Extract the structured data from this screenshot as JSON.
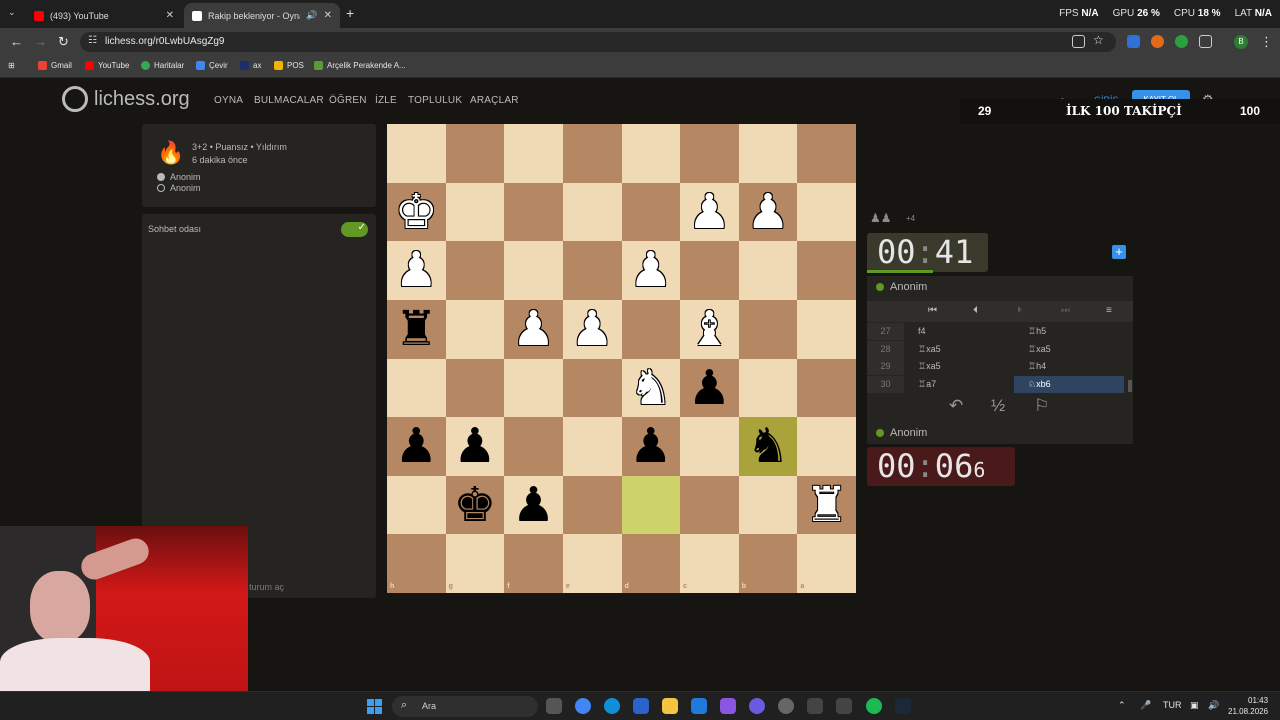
{
  "browser": {
    "tabs": [
      {
        "label": "(493) YouTube",
        "favicon": "youtube-icon"
      },
      {
        "label": "Rakip bekleniyor - Oyna Ar",
        "favicon": "lichess-icon"
      }
    ],
    "url": "lichess.org/r0LwbUAsgZg9",
    "bookmarks": [
      "Gmail",
      "YouTube",
      "Haritalar",
      "Çevir",
      "ax",
      "POS",
      "Arçelik Perakende A..."
    ]
  },
  "hud": {
    "fps_label": "FPS",
    "fps": "N/A",
    "gpu_label": "GPU",
    "gpu": "26 %",
    "cpu_label": "CPU",
    "cpu": "18 %",
    "lat_label": "LAT",
    "lat": "N/A"
  },
  "lichess": {
    "logo": "lichess.org",
    "menu": [
      "OYNA",
      "BULMACALAR",
      "ÖĞREN",
      "İZLE",
      "TOPLULUK",
      "ARAÇLAR"
    ],
    "signin": "GİRİŞ",
    "signup": "KAYIT OL"
  },
  "banner": {
    "left": "29",
    "title": "İLK 100 TAKİPÇİ",
    "right": "100"
  },
  "game": {
    "type": "3+2 • Puansız • Yıldırım",
    "time_ago": "6 dakika önce",
    "players": [
      "Anonim",
      "Anonim"
    ]
  },
  "chat": {
    "title": "Sohbet odası",
    "input_hint": "turum aç"
  },
  "board": {
    "ranks": [
      "1",
      "2",
      "3",
      "4",
      "5",
      "6",
      "7",
      "8"
    ],
    "files": [
      "h",
      "g",
      "f",
      "e",
      "d",
      "c",
      "b",
      "a"
    ],
    "pieces": [
      {
        "sq": [
          1,
          0
        ],
        "glyph": "♚",
        "color": "w"
      },
      {
        "sq": [
          1,
          5
        ],
        "glyph": "♟",
        "color": "w"
      },
      {
        "sq": [
          1,
          6
        ],
        "glyph": "♟",
        "color": "w"
      },
      {
        "sq": [
          2,
          0
        ],
        "glyph": "♟",
        "color": "w"
      },
      {
        "sq": [
          2,
          4
        ],
        "glyph": "♟",
        "color": "w"
      },
      {
        "sq": [
          3,
          0
        ],
        "glyph": "♜",
        "color": "b"
      },
      {
        "sq": [
          3,
          2
        ],
        "glyph": "♟",
        "color": "w"
      },
      {
        "sq": [
          3,
          3
        ],
        "glyph": "♟",
        "color": "w"
      },
      {
        "sq": [
          3,
          5
        ],
        "glyph": "♝",
        "color": "w"
      },
      {
        "sq": [
          4,
          4
        ],
        "glyph": "♞",
        "color": "w"
      },
      {
        "sq": [
          4,
          5
        ],
        "glyph": "♟",
        "color": "b"
      },
      {
        "sq": [
          5,
          0
        ],
        "glyph": "♟",
        "color": "b"
      },
      {
        "sq": [
          5,
          1
        ],
        "glyph": "♟",
        "color": "b"
      },
      {
        "sq": [
          5,
          4
        ],
        "glyph": "♟",
        "color": "b"
      },
      {
        "sq": [
          5,
          6
        ],
        "glyph": "♞",
        "color": "b"
      },
      {
        "sq": [
          6,
          1
        ],
        "glyph": "♚",
        "color": "b"
      },
      {
        "sq": [
          6,
          2
        ],
        "glyph": "♟",
        "color": "b"
      },
      {
        "sq": [
          6,
          7
        ],
        "glyph": "♜",
        "color": "w"
      }
    ],
    "highlights": [
      [
        5,
        6
      ],
      [
        6,
        4
      ]
    ],
    "colors": {
      "light": "#f0d9b5",
      "dark": "#b58863",
      "highlight": "#cdd26a"
    }
  },
  "clocks": {
    "top": {
      "mm": "00",
      "ss": "41"
    },
    "bottom": {
      "mm": "00",
      "ss": "06",
      "tenths": "6"
    }
  },
  "captured": {
    "diff": "+4"
  },
  "players": {
    "top": "Anonim",
    "bottom": "Anonim"
  },
  "moves": [
    {
      "n": "27",
      "w": "f4",
      "b": "♖h5"
    },
    {
      "n": "28",
      "w": "♖xa5",
      "b": "♖xa5"
    },
    {
      "n": "29",
      "w": "♖xa5",
      "b": "♖h4"
    },
    {
      "n": "30",
      "w": "♖a7",
      "b": "♘xb6"
    }
  ],
  "actions": [
    "takeback-icon",
    "½",
    "resign-flag-icon"
  ],
  "taskbar": {
    "search": "Ara",
    "lang": "TUR",
    "time": "01:43",
    "date": "21.08.2026"
  }
}
